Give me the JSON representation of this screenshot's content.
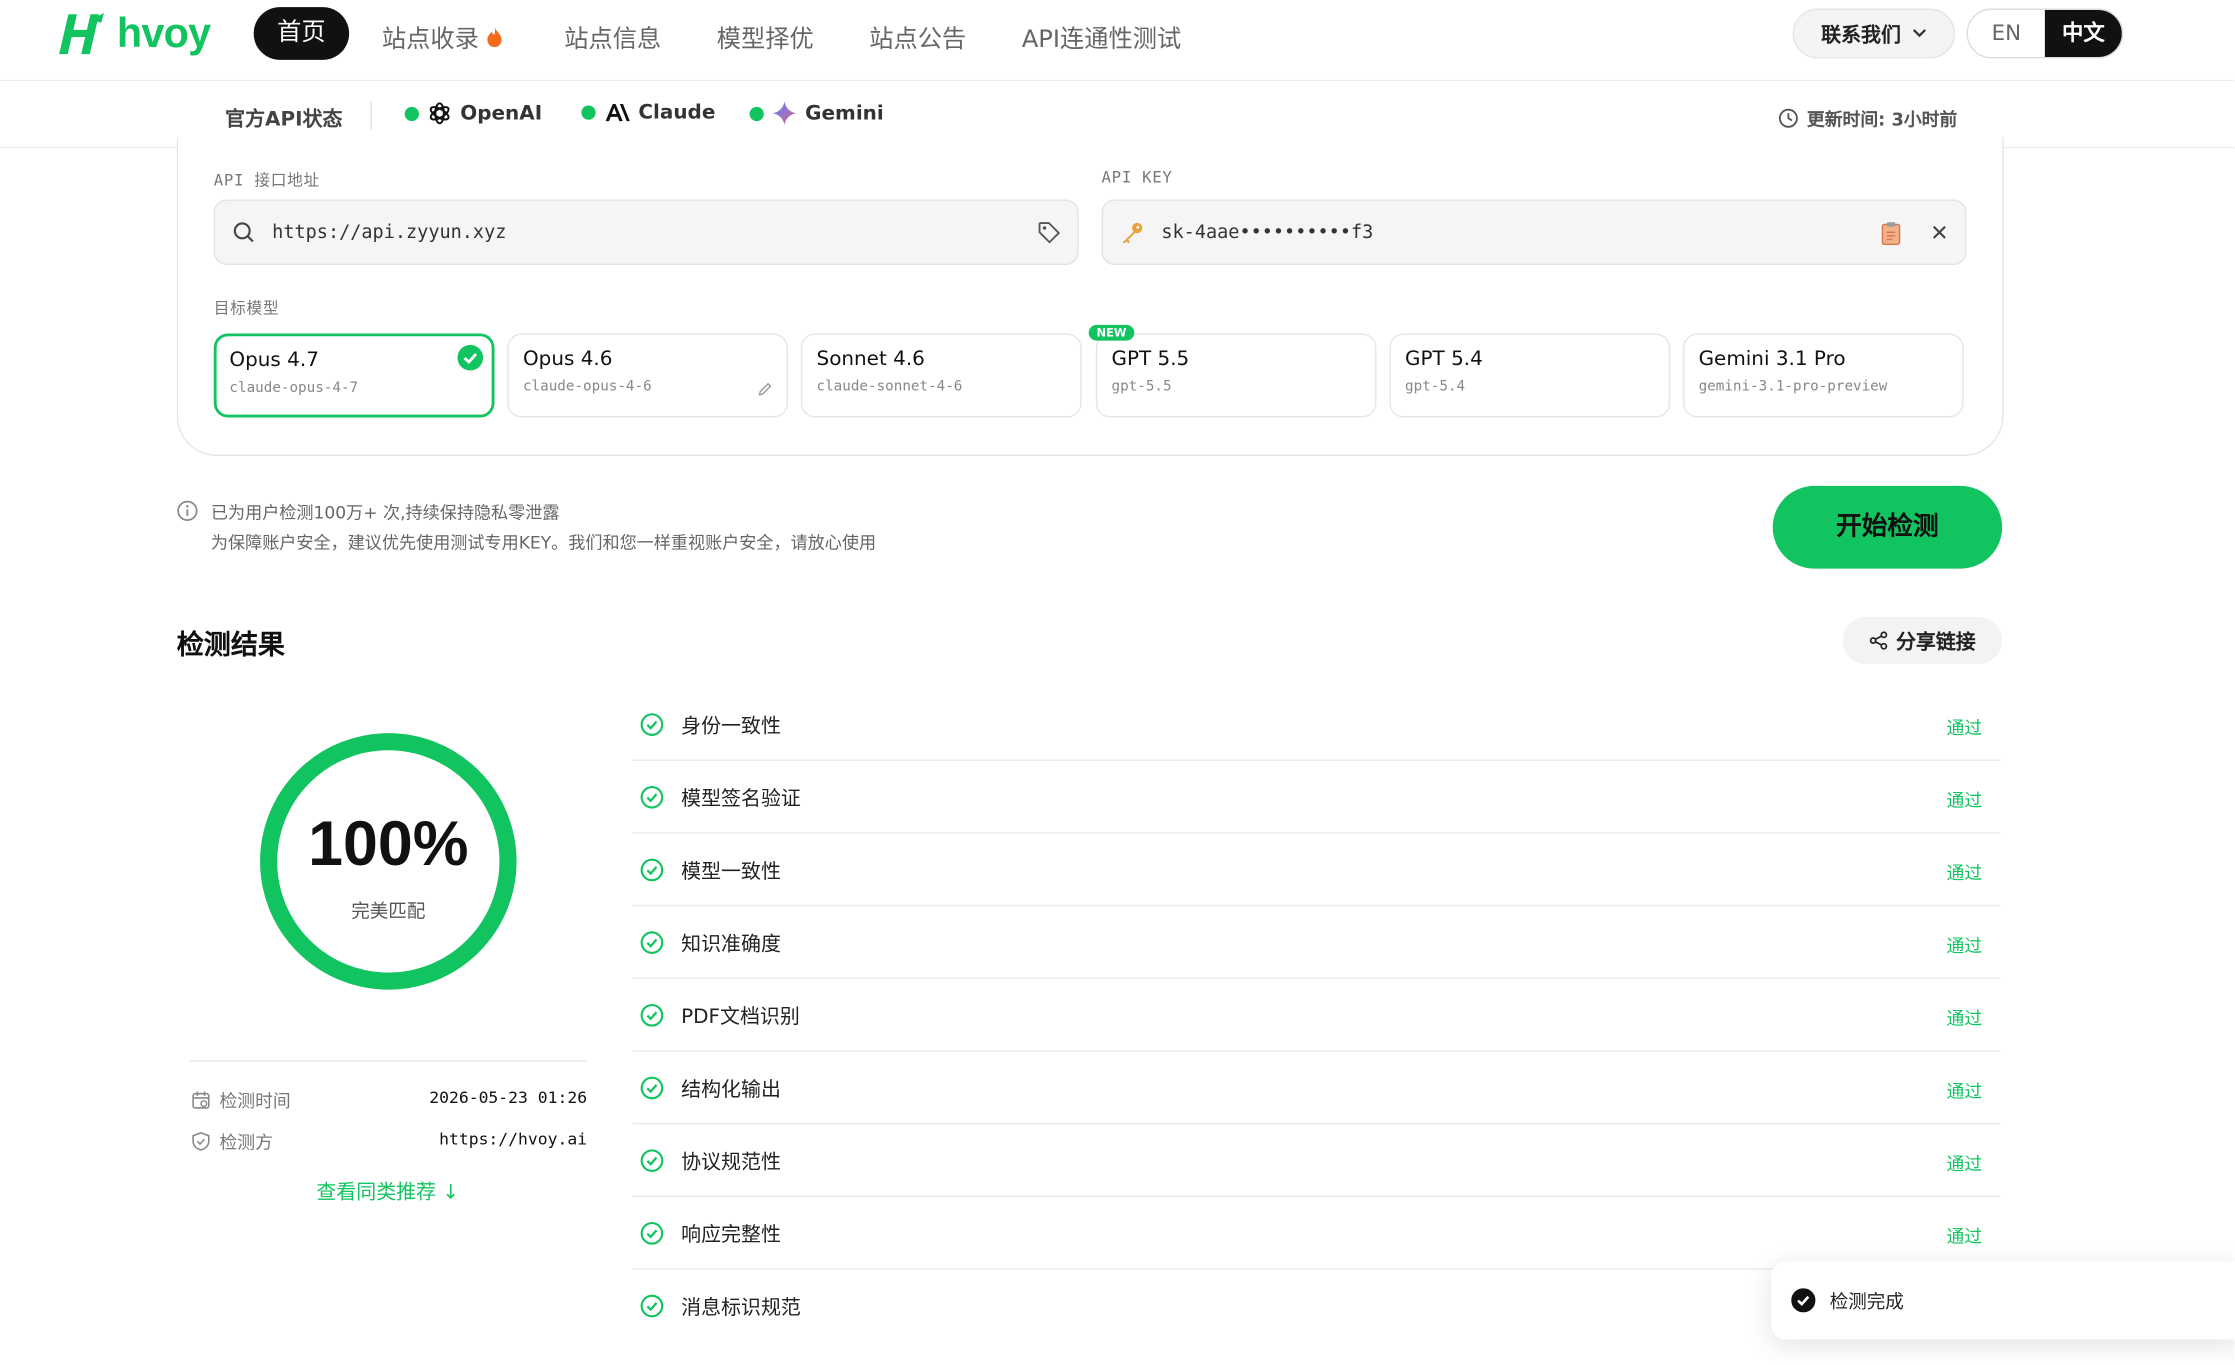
{
  "nav": {
    "logo_text": "hvoy",
    "items": [
      "首页",
      "站点收录",
      "站点信息",
      "模型择优",
      "站点公告",
      "API连通性测试"
    ],
    "contact": "联系我们",
    "lang_en": "EN",
    "lang_zh": "中文"
  },
  "status": {
    "label": "官方API状态",
    "providers": [
      "OpenAI",
      "Claude",
      "Gemini"
    ],
    "updated": "更新时间: 3小时前"
  },
  "form": {
    "api_label": "API 接口地址",
    "api_value": "https://api.zyyun.xyz",
    "key_label": "API KEY",
    "key_value": "sk-4aae••••••••••f3",
    "models_label": "目标模型",
    "new_tag": "NEW",
    "models": [
      {
        "name": "Opus 4.7",
        "id": "claude-opus-4-7"
      },
      {
        "name": "Opus 4.6",
        "id": "claude-opus-4-6"
      },
      {
        "name": "Sonnet 4.6",
        "id": "claude-sonnet-4-6"
      },
      {
        "name": "GPT 5.5",
        "id": "gpt-5.5"
      },
      {
        "name": "GPT 5.4",
        "id": "gpt-5.4"
      },
      {
        "name": "Gemini 3.1 Pro",
        "id": "gemini-3.1-pro-preview"
      }
    ]
  },
  "notice": {
    "line1": "已为用户检测100万+ 次,持续保持隐私零泄露",
    "line2": "为保障账户安全，建议优先使用测试专用KEY。我们和您一样重视账户安全，请放心使用"
  },
  "start_button": "开始检测",
  "results": {
    "title": "检测结果",
    "share": "分享链接",
    "score": "100%",
    "score_progress": 1.0,
    "score_label": "完美匹配",
    "time_label": "检测时间",
    "time_value": "2026-05-23 01:26",
    "by_label": "检测方",
    "by_value": "https://hvoy.ai",
    "more": "查看同类推荐 ↓",
    "pass_text": "通过",
    "checks": [
      "身份一致性",
      "模型签名验证",
      "模型一致性",
      "知识准确度",
      "PDF文档识别",
      "结构化输出",
      "协议规范性",
      "响应完整性",
      "消息标识规范"
    ]
  },
  "toast": "检测完成",
  "colors": {
    "accent": "#12c45f",
    "dark": "#111111"
  }
}
